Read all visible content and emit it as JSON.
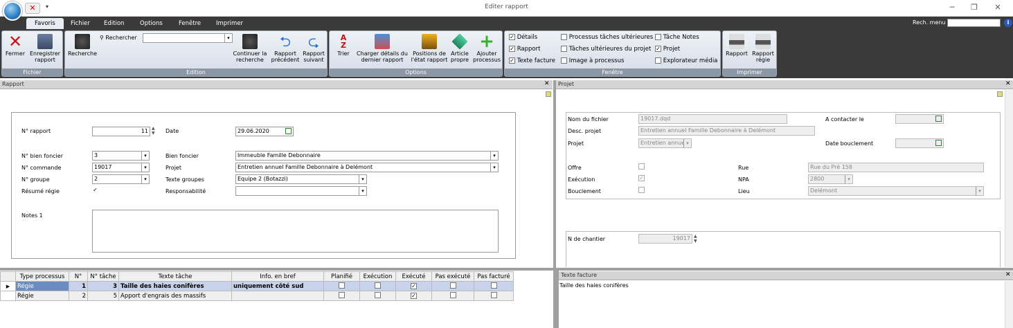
{
  "window": {
    "title": "Editer rapport"
  },
  "tabs": [
    "Favoris",
    "Fichier",
    "Edition",
    "Options",
    "Fenêtre",
    "Imprimer"
  ],
  "menu_search": {
    "label": "Rech. menu"
  },
  "ribbon": {
    "fichier": {
      "label": "Fichier",
      "close": "Fermer",
      "save": "Enregistrer rapport"
    },
    "edition": {
      "label": "Edition",
      "search": "Recherche",
      "search_small": "Rechercher",
      "continue": "Continuer la recherche",
      "prev": "Rapport précédent",
      "next": "Rapport suivant"
    },
    "options": {
      "label": "Options",
      "sort": "Trier",
      "load": "Charger détails du dernier rapport",
      "positions": "Positions de l'état rapport",
      "article": "Article propre",
      "add": "Ajouter processus"
    },
    "fenetre": {
      "label": "Fenêtre",
      "items": [
        {
          "label": "Détails",
          "checked": true
        },
        {
          "label": "Rapport",
          "checked": true
        },
        {
          "label": "Texte facture",
          "checked": true
        },
        {
          "label": "Processus tâches ultérieures",
          "checked": false
        },
        {
          "label": "Tâches ultérieures du projet",
          "checked": false
        },
        {
          "label": "Image à processus",
          "checked": false
        },
        {
          "label": "Tâche Notes",
          "checked": false
        },
        {
          "label": "Projet",
          "checked": true
        },
        {
          "label": "Explorateur média",
          "checked": false
        }
      ]
    },
    "imprimer": {
      "label": "Imprimer",
      "rapport": "Rapport",
      "regie": "Rapport régie"
    }
  },
  "rapport": {
    "header": "Rapport",
    "num_label": "N° rapport",
    "num": "11",
    "date_label": "Date",
    "date": "29.06.2020",
    "bien_label": "N° bien foncier",
    "bien": "3",
    "bien_f_label": "Bien foncier",
    "bien_f": "Immeuble Famille Debonnaire",
    "cmd_label": "N° commande",
    "cmd": "19017",
    "projet_label": "Projet",
    "projet": "Entretien annuel Famille Debonnaire à Delémont",
    "grp_label": "N° groupe",
    "grp": "2",
    "txtgrp_label": "Texte groupes",
    "txtgrp": "Equipe 2 (Botazzi)",
    "resume_label": "Résumé régie",
    "resp_label": "Responsabilité",
    "resp": "",
    "notes_label": "Notes 1"
  },
  "projet": {
    "header": "Projet",
    "fichier_label": "Nom du fichier",
    "fichier": "19017.dqd",
    "desc_label": "Desc. projet",
    "desc": "Entretien annuel Famille Debonnaire à Delémont",
    "projet_label": "Projet",
    "projet": "Entretien annue",
    "contact_label": "A contacter le",
    "bouclement_date_label": "Date bouclement",
    "offre_label": "Offre",
    "exec_label": "Exécution",
    "boucl_label": "Bouclement",
    "rue_label": "Rue",
    "rue": "Rue du Pré 158",
    "npa_label": "NPA",
    "npa": "2800",
    "lieu_label": "Lieu",
    "lieu": "Delémont",
    "chantier_label": "N de chantier",
    "chantier": "19017"
  },
  "grid": {
    "columns": [
      "Type processus",
      "N°",
      "N° tâche",
      "Texte tâche",
      "Info. en bref",
      "Planifié",
      "Exécution",
      "Exécuté",
      "Pas exécuté",
      "Pas facturé"
    ],
    "rows": [
      {
        "type": "Régie",
        "n": "1",
        "tache": "3",
        "texte": "Taille des haies conifères",
        "info": "uniquement côté sud",
        "planifie": false,
        "execution": false,
        "execute": true,
        "pas_exec": false,
        "pas_fact": false
      },
      {
        "type": "Régie",
        "n": "2",
        "tache": "5",
        "texte": "Apport d'engrais des massifs",
        "info": "",
        "planifie": false,
        "execution": false,
        "execute": true,
        "pas_exec": false,
        "pas_fact": false
      }
    ]
  },
  "texte_facture": {
    "header": "Texte facture",
    "content": "Taille des haies conifères"
  }
}
